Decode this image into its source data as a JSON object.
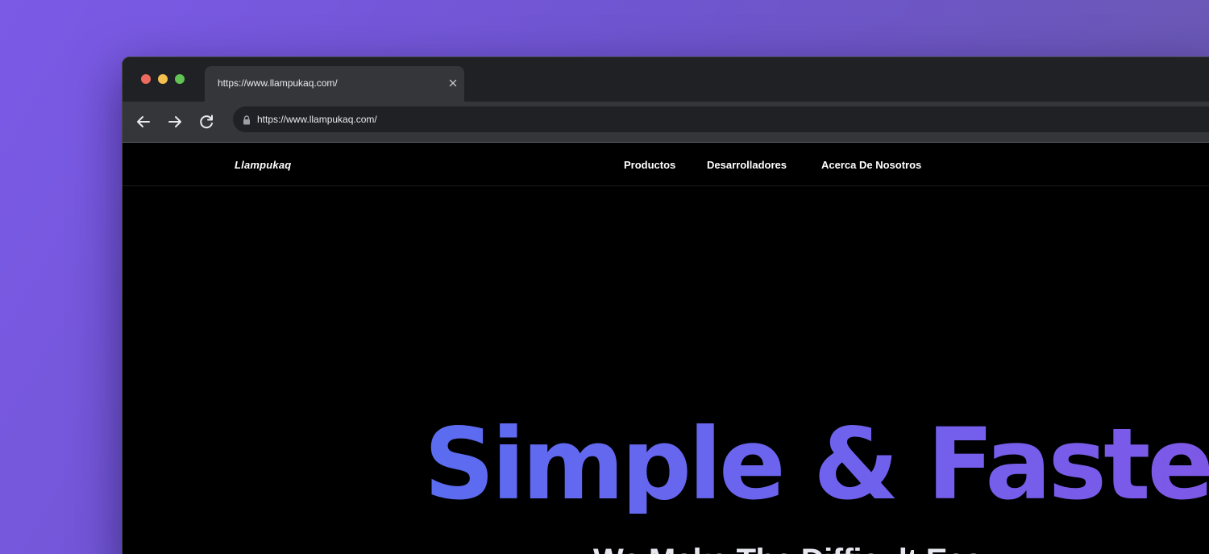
{
  "browser": {
    "tab": {
      "title": "https://www.llampukaq.com/",
      "close_icon": "close-icon"
    },
    "toolbar": {
      "back_icon": "arrow-left-icon",
      "forward_icon": "arrow-right-icon",
      "reload_icon": "reload-icon",
      "lock_icon": "lock-icon",
      "url": "https://www.llampukaq.com/"
    },
    "traffic_lights": {
      "close_color": "#ed6a5e",
      "minimize_color": "#f5bf4f",
      "maximize_color": "#61c454"
    }
  },
  "site": {
    "logo": "Llampukaq",
    "nav": [
      {
        "label": "Productos"
      },
      {
        "label": "Desarrolladores"
      },
      {
        "label": "Acerca De Nosotros"
      }
    ],
    "hero": {
      "title": "Simple & Faster",
      "subtitle": "We Make The Difficult Easy"
    },
    "colors": {
      "hero_gradient_start": "#5a6cf0",
      "hero_gradient_end": "#7f57e6",
      "background": "#000000"
    }
  }
}
